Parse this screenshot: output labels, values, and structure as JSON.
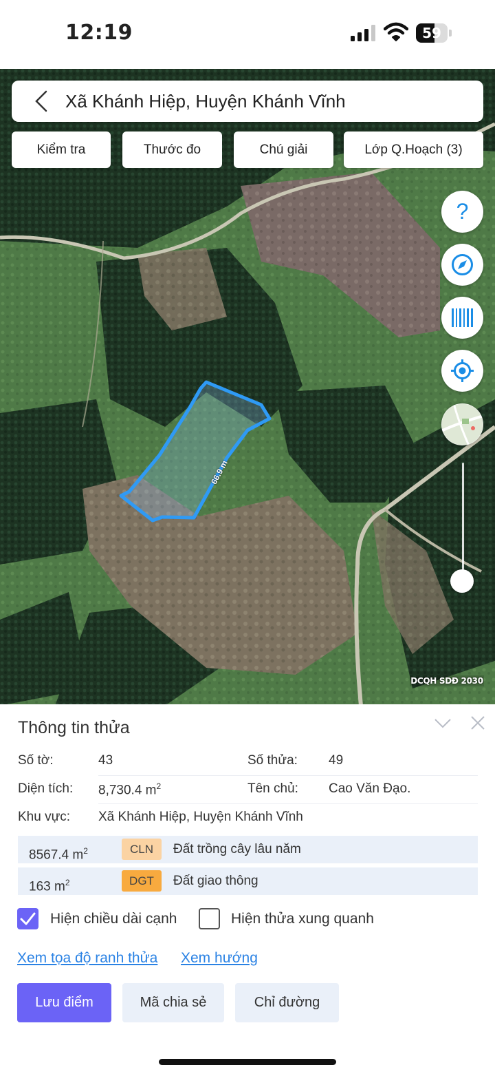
{
  "status_bar": {
    "time": "12:19",
    "battery": "59",
    "battery_level_percent": 59
  },
  "search": {
    "back_icon": "chevron-left-icon",
    "title": "Xã Khánh Hiệp, Huyện Khánh Vĩnh"
  },
  "toolbar": {
    "buttons": [
      {
        "label": "Kiểm tra"
      },
      {
        "label": "Thước đo"
      },
      {
        "label": "Chú giải"
      },
      {
        "label": "Lớp Q.Hoạch (3)"
      }
    ]
  },
  "map": {
    "parcel_measure": "66.9 m",
    "watermark": "DCQH SDĐ 2030",
    "parcel_color": "#2f9af5",
    "controls": [
      "help-icon",
      "compass-icon",
      "barcode-icon",
      "locate-icon",
      "layers-thumbnail-icon"
    ]
  },
  "panel": {
    "title": "Thông tin thửa",
    "so_to_label": "Số tờ:",
    "so_to_value": "43",
    "so_thua_label": "Số thửa:",
    "so_thua_value": "49",
    "dien_tich_label": "Diện tích:",
    "dien_tich_value": "8,730.4 m",
    "area_unit_sup": "2",
    "ten_chu_label": "Tên chủ:",
    "ten_chu_value": "Cao Văn Đạo.",
    "khu_vuc_label": "Khu vực:",
    "khu_vuc_value": "Xã Khánh Hiệp, Huyện Khánh Vĩnh",
    "land_uses": [
      {
        "area": "8567.4 m",
        "sup": "2",
        "code": "CLN",
        "name": "Đất trồng cây lâu năm",
        "code_color": "#fbd3a3"
      },
      {
        "area": "163 m",
        "sup": "2",
        "code": "DGT",
        "name": "Đất giao thông",
        "code_color": "#f8aa3f"
      }
    ],
    "show_edge_length": {
      "label": "Hiện chiều dài cạnh",
      "checked": true
    },
    "show_neighbors": {
      "label": "Hiện thửa xung quanh",
      "checked": false
    },
    "link_coords": "Xem tọa độ ranh thửa",
    "link_direction": "Xem hướng",
    "btn_save": "Lưu điểm",
    "btn_share": "Mã chia sẻ",
    "btn_route": "Chỉ đường"
  },
  "colors": {
    "accent": "#6b63f6",
    "link": "#2a82e4",
    "icon_blue": "#1a8de6"
  }
}
